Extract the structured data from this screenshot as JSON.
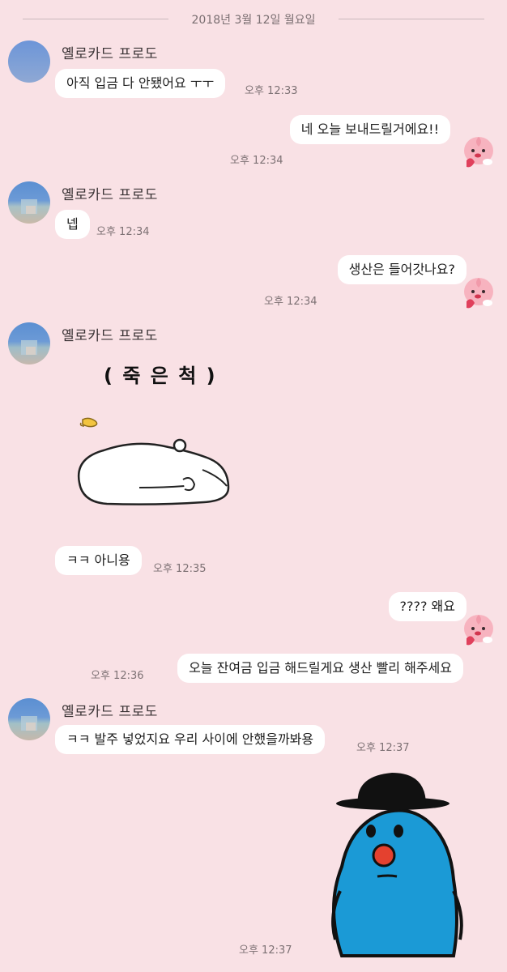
{
  "date_separator": "2018년 3월 12일 월요일",
  "sender_name": "옐로카드 프로도",
  "messages": [
    {
      "text": "아직 입금 다 안됐어요 ㅜㅜ",
      "time": "오후 12:33"
    },
    {
      "text": "네 오늘 보내드릴거에요!!",
      "time": "오후 12:34"
    },
    {
      "text": "넵",
      "time": "오후 12:34"
    },
    {
      "text": "생산은 들어갓나요?",
      "time": "오후 12:34"
    },
    {
      "text": "ㅋㅋ 아니용",
      "time": "오후 12:35"
    },
    {
      "text": "???? 왜요",
      "time": ""
    },
    {
      "text": "오늘 잔여금 입금 해드릴게요 생산 빨리 해주세요",
      "time": "오후 12:36"
    },
    {
      "text": "ㅋㅋ 발주 넣었지요 우리 사이에 안했을까봐용",
      "time": "오후 12:37"
    }
  ],
  "sticker_caption": "( 죽 은 척 )",
  "last_time": "오후 12:37",
  "colors": {
    "background": "#f9e1e5",
    "bubble": "#ffffff",
    "time": "#7d7174"
  },
  "icons": [
    "profile-avatar",
    "peach-emoticon",
    "dead-bear-sticker",
    "blue-character-sticker"
  ]
}
